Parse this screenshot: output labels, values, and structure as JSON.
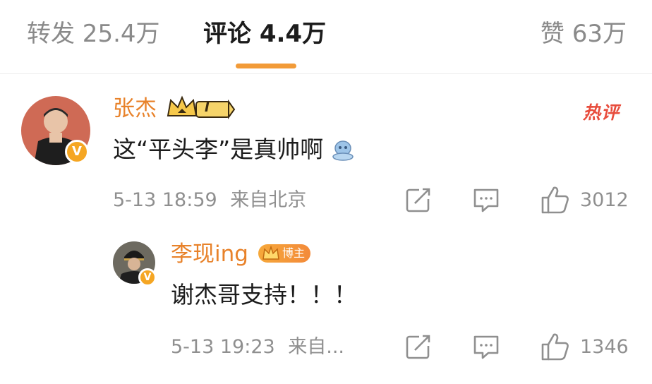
{
  "tabs": {
    "repost": "转发 25.4万",
    "comment": "评论 4.4万",
    "like": "赞 63万"
  },
  "comments": [
    {
      "user": "张杰",
      "level": "I",
      "tag": "热评",
      "text": "这“平头李”是真帅啊",
      "time": "5-13 18:59",
      "location": "来自北京",
      "likes": "3012"
    },
    {
      "user": "李现ing",
      "badge": "博主",
      "text": "谢杰哥支持！！！",
      "time": "5-13 19:23",
      "location": "来自...",
      "likes": "1346"
    }
  ],
  "colors": {
    "accent": "#f29b38",
    "username": "#e8822a",
    "hot": "#e84d3d",
    "meta": "#8f8f8f"
  },
  "icons": [
    "crown-icon",
    "v-verified-icon",
    "share-icon",
    "comment-icon",
    "thumbs-up-icon"
  ]
}
